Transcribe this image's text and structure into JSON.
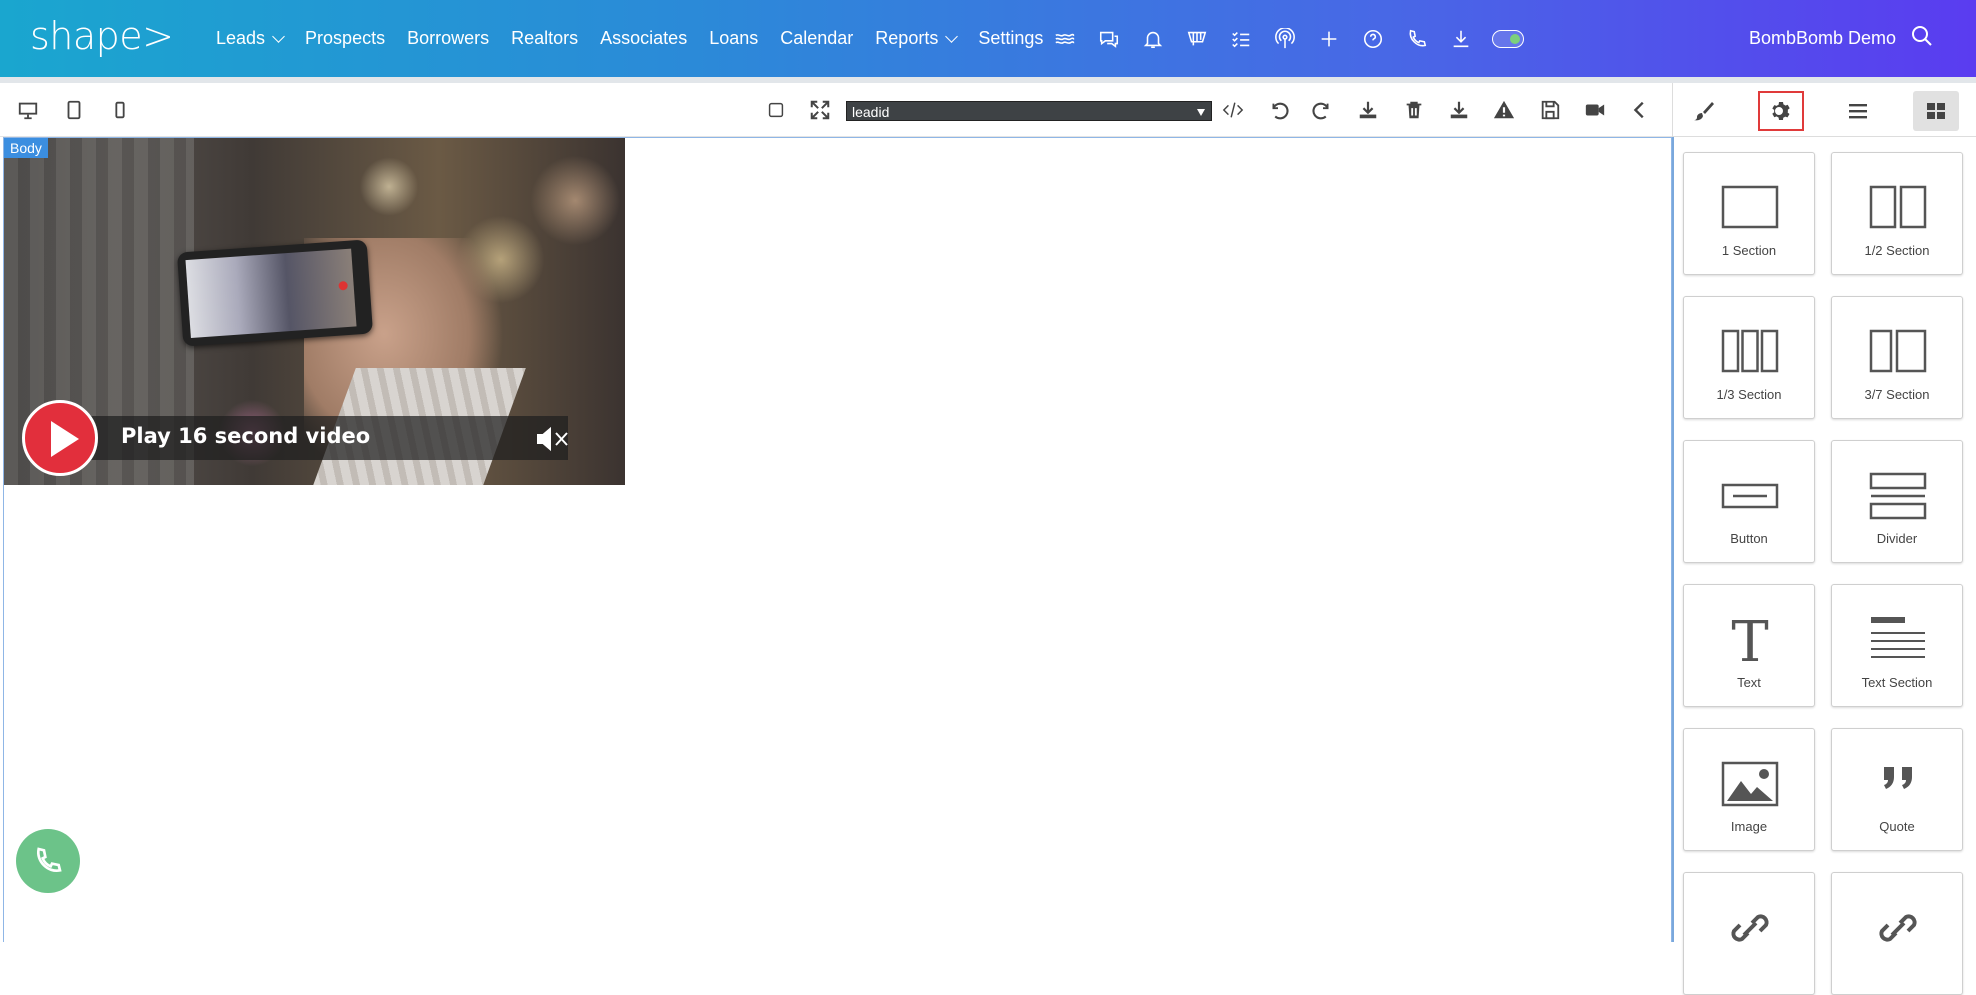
{
  "app": {
    "logo_text": "shape>"
  },
  "nav": {
    "items": [
      {
        "label": "Leads",
        "dropdown": true
      },
      {
        "label": "Prospects"
      },
      {
        "label": "Borrowers"
      },
      {
        "label": "Realtors"
      },
      {
        "label": "Associates"
      },
      {
        "label": "Loans"
      },
      {
        "label": "Calendar"
      },
      {
        "label": "Reports",
        "dropdown": true
      },
      {
        "label": "Settings"
      }
    ],
    "icons": [
      "waves-icon",
      "chat-icon",
      "bell-icon",
      "megaphone-icon",
      "checklist-icon",
      "broadcast-icon",
      "plus-icon",
      "help-icon",
      "phone-icon",
      "download-icon",
      "toggle-switch"
    ],
    "user_name": "BombBomb Demo"
  },
  "toolbar": {
    "select_value": "leadid",
    "device_icons": [
      "desktop-icon",
      "tablet-icon",
      "mobile-icon"
    ],
    "action_icons": [
      "checkbox-icon",
      "fullscreen-icon",
      "code-icon",
      "undo-icon",
      "redo-icon",
      "download-icon",
      "trash-icon",
      "import-icon",
      "warning-icon",
      "save-icon",
      "video-icon",
      "collapse-icon"
    ]
  },
  "canvas": {
    "body_tag": "Body",
    "video_caption": "Play 16 second video"
  },
  "panel": {
    "tabs": [
      "brush-icon",
      "gear-icon",
      "menu-icon",
      "blocks-icon"
    ],
    "active_tab": "gear-icon",
    "selected_tab": "blocks-icon",
    "blocks": [
      {
        "label": "1 Section"
      },
      {
        "label": "1/2 Section"
      },
      {
        "label": "1/3 Section"
      },
      {
        "label": "3/7 Section"
      },
      {
        "label": "Button"
      },
      {
        "label": "Divider"
      },
      {
        "label": "Text"
      },
      {
        "label": "Text Section"
      },
      {
        "label": "Image"
      },
      {
        "label": "Quote"
      },
      {
        "label": ""
      },
      {
        "label": ""
      }
    ]
  },
  "colors": {
    "accent": "#3b8ee0",
    "play": "#e22f3c",
    "fab": "#6cc389",
    "highlight": "#e03a3a"
  }
}
